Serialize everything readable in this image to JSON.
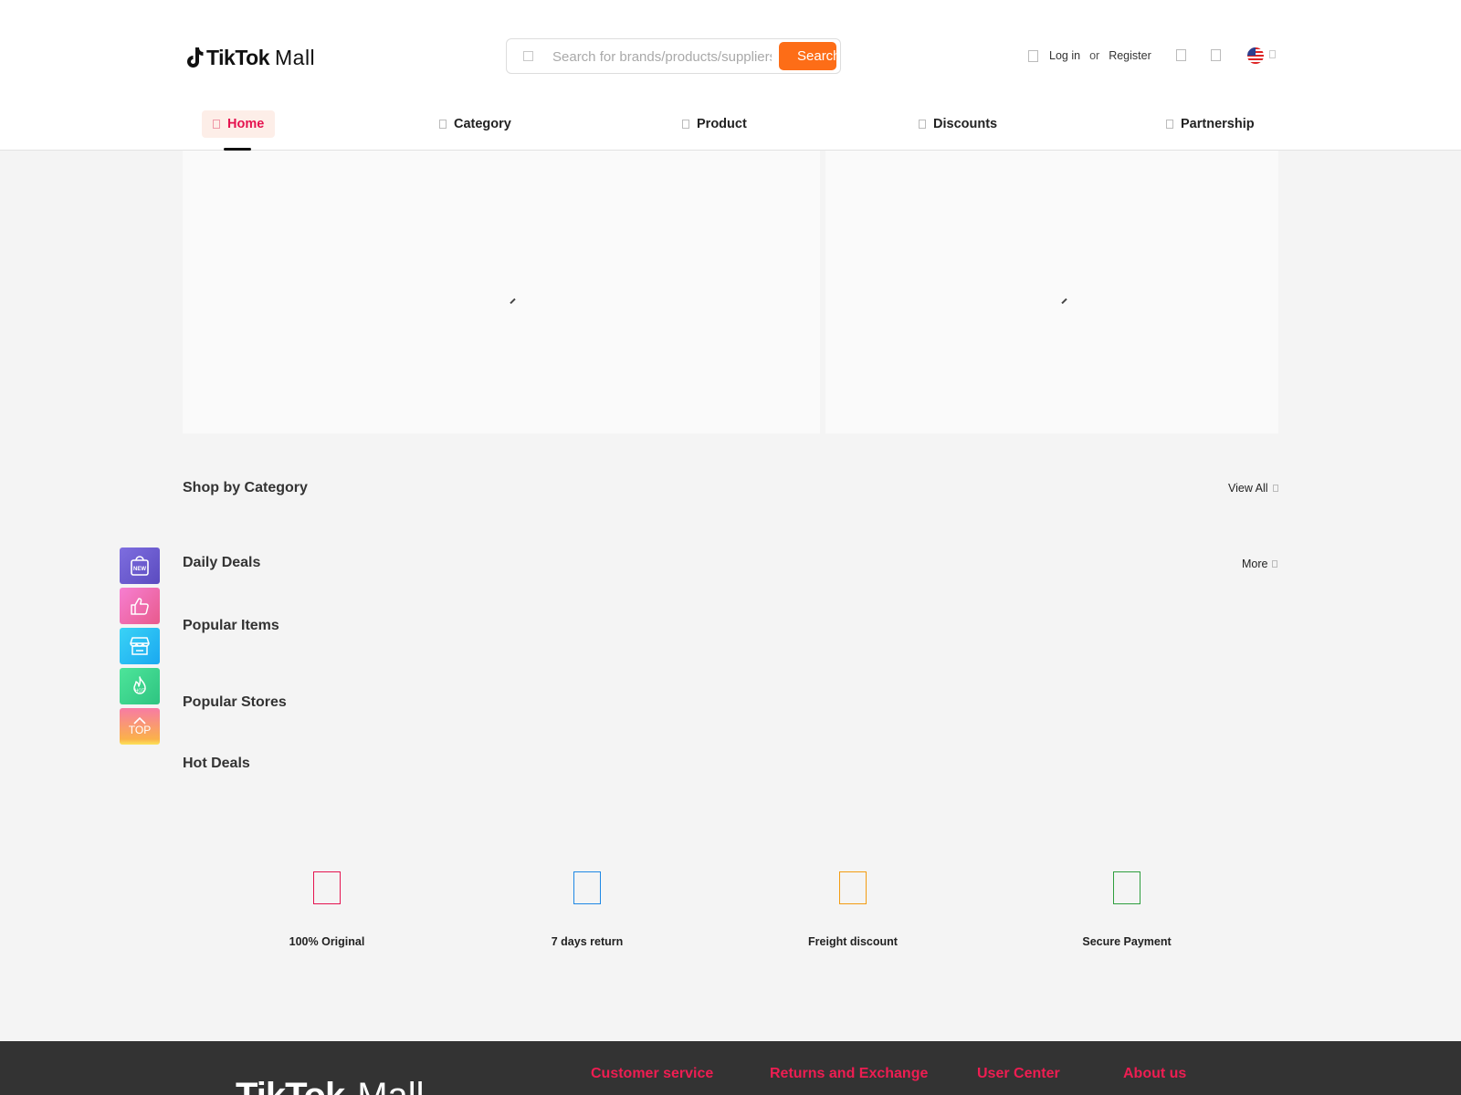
{
  "header": {
    "logo": {
      "brand": "TikTok",
      "suffix": "Mall"
    },
    "search": {
      "placeholder": "Search for brands/products/suppliers",
      "value": "",
      "button_label": "Search"
    },
    "user": {
      "login": "Log in",
      "or": "or",
      "register": "Register"
    },
    "icons": {
      "cart": "cart-icon",
      "message": "message-icon",
      "language": "us-flag-icon"
    }
  },
  "nav": {
    "items": [
      {
        "label": "Home",
        "active": true
      },
      {
        "label": "Category",
        "active": false
      },
      {
        "label": "Product",
        "active": false
      },
      {
        "label": "Discounts",
        "active": false
      },
      {
        "label": "Partnership",
        "active": false
      }
    ]
  },
  "sections": {
    "shop_by_category": {
      "title": "Shop by Category",
      "link": "View All"
    },
    "daily_deals": {
      "title": "Daily Deals",
      "link": "More"
    },
    "popular_items": {
      "title": "Popular Items"
    },
    "popular_stores": {
      "title": "Popular Stores"
    },
    "hot_deals": {
      "title": "Hot Deals"
    }
  },
  "sidebar": {
    "buttons": [
      {
        "icon": "new-bag-icon",
        "text": "NEW"
      },
      {
        "icon": "thumbs-up-icon"
      },
      {
        "icon": "store-icon"
      },
      {
        "icon": "hot-fire-icon",
        "text": "HOT"
      },
      {
        "icon": "arrow-up-icon",
        "label": "TOP"
      }
    ]
  },
  "features": [
    {
      "label": "100% Original",
      "color": "#e5134f"
    },
    {
      "label": "7 days return",
      "color": "#1e88e5"
    },
    {
      "label": "Freight discount",
      "color": "#f39c12"
    },
    {
      "label": "Secure Payment",
      "color": "#2e9e3e"
    }
  ],
  "footer": {
    "logo": {
      "brand": "TikTok",
      "suffix": "Mall"
    },
    "columns": [
      "Customer service",
      "Returns and Exchange",
      "User Center",
      "About us"
    ]
  },
  "colors": {
    "accent": "#e5134f",
    "search_button": "#fd6d17",
    "footer_bg": "#333333",
    "footer_heading": "#ee1d52"
  }
}
